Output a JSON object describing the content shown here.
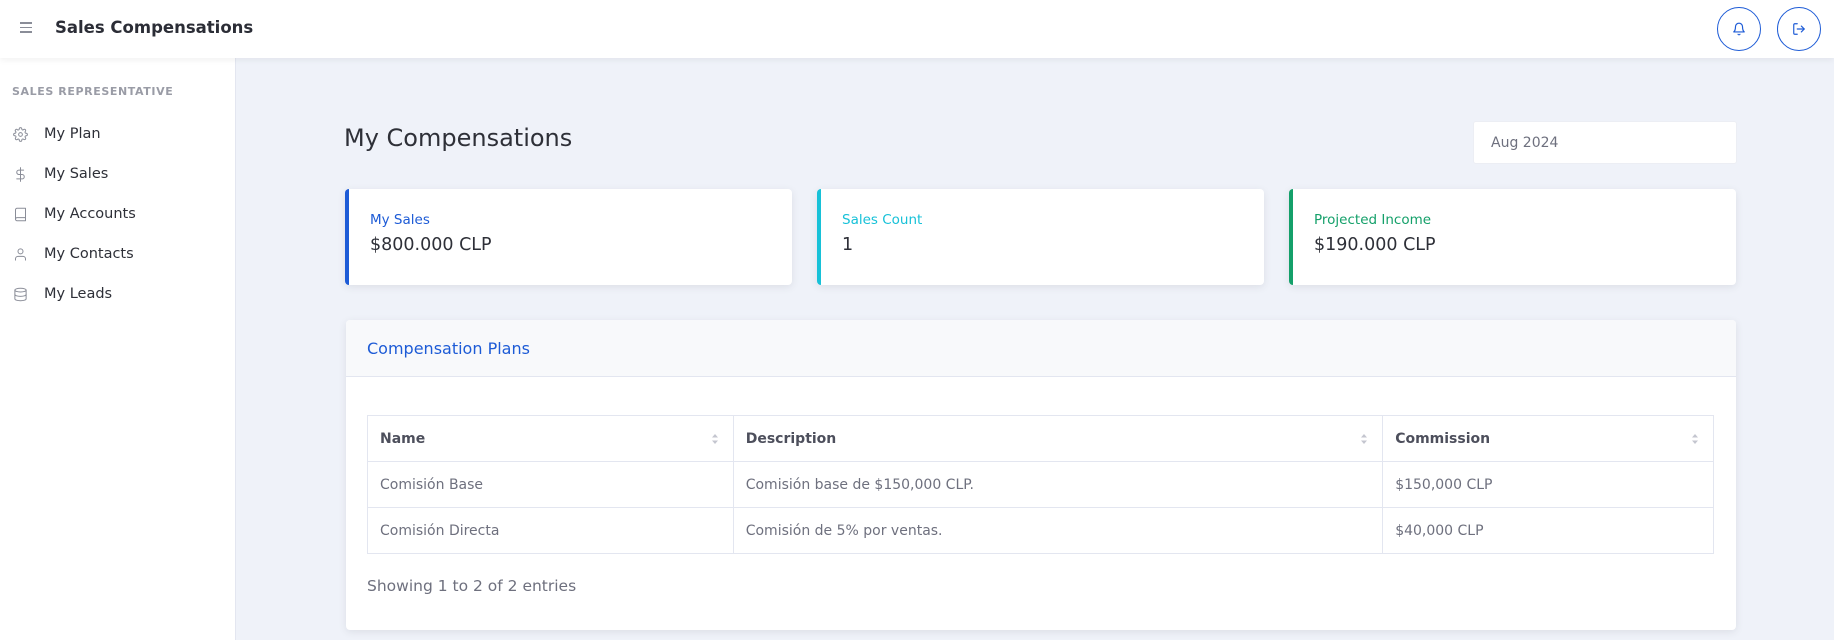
{
  "app": {
    "title": "Sales Compensations"
  },
  "sidebar": {
    "heading": "SALES REPRESENTATIVE",
    "items": [
      {
        "label": "My Plan",
        "icon": "gear-icon"
      },
      {
        "label": "My Sales",
        "icon": "dollar-icon"
      },
      {
        "label": "My Accounts",
        "icon": "book-icon"
      },
      {
        "label": "My Contacts",
        "icon": "person-icon"
      },
      {
        "label": "My Leads",
        "icon": "database-icon"
      }
    ]
  },
  "header": {
    "icons": [
      "menu-icon",
      "bell-icon",
      "logout-icon"
    ]
  },
  "main": {
    "title": "My Compensations",
    "month_value": "Aug 2024",
    "cards": [
      {
        "label": "My Sales",
        "value": "$800.000 CLP",
        "color": "#1d5bd6"
      },
      {
        "label": "Sales Count",
        "value": "1",
        "color": "#17c1d8"
      },
      {
        "label": "Projected Income",
        "value": "$190.000 CLP",
        "color": "#14a06a"
      }
    ],
    "panel": {
      "title": "Compensation Plans",
      "columns": [
        "Name",
        "Description",
        "Commission"
      ],
      "rows": [
        [
          "Comisión Base",
          "Comisión base de $150,000 CLP.",
          "$150,000 CLP"
        ],
        [
          "Comisión Directa",
          "Comisión de 5% por ventas.",
          "$40,000 CLP"
        ]
      ],
      "entries_info": "Showing 1 to 2 of 2 entries"
    }
  },
  "colors": {
    "accent": "#1d5bd6",
    "background": "#eff2f9"
  }
}
